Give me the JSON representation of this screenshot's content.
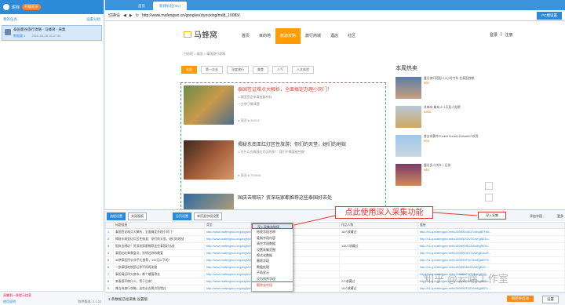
{
  "left": {
    "user": "昵称",
    "upgrade": "升级会员",
    "section": "我的任务",
    "section_action": "设置分组",
    "task_title": "泰国曼谷旅行攻略 - 马蜂窝 - 采集",
    "task_status": "数据量 1",
    "task_time": "2019-05-28 10:47:45",
    "notice": "采集到一条提示信息",
    "tutorial": "使用说明",
    "version": "软件版本: 2.1.22"
  },
  "browser": {
    "tabs": [
      "首页",
      "新建标签(Inc)"
    ],
    "mode": "切换设",
    "url": "http://www.mafengwo.cn/gonglve/ziyouxing/mdd_10083/",
    "pc_button": "PC端设置"
  },
  "site": {
    "logo_text": "马蜂窝",
    "nav": [
      "首页",
      "目的地",
      "旅游攻略",
      "旅行商城",
      "酒店",
      "社区"
    ],
    "login": [
      "登录",
      "|",
      "注册"
    ],
    "breadcrumb": "目的地 > 泰国 > 泰国旅行攻略",
    "chips": [
      "全部",
      "第一次去",
      "深度旅行",
      "美食",
      "人气",
      "人文体验"
    ],
    "articles": [
      {
        "title": "泰国签证难点大解析，全面搞定办理小窍门！",
        "sub": "1.泰国签证申请准备材料",
        "sub2": "一分钟了解清楚",
        "meta": "● 泰国 ● 36914"
      },
      {
        "title": "揭秘东南亚红灯区性旅游：你们的天堂，她们的地狱",
        "sub": "1.为什么去泰国红灯区的多？\"我们不需要被拯救\"",
        "sub2": "",
        "meta": "● 泰国 ● 763606"
      },
      {
        "title": "国庆去哪玩？资深玩家都推荐这些泰国好去处",
        "sub": "",
        "sub2": "",
        "meta": ""
      }
    ],
    "hot_title": "本周热卖",
    "hot": [
      {
        "desc": "曼谷旅行搭配 2.4小时专车 在泰国首都",
        "price": "¥55"
      },
      {
        "desc": "苏梅岛·象岛 4+1天双人船票",
        "price": "¥265"
      },
      {
        "desc": "普吉岛奢华Phuket Sunset Cabaret人妖秀",
        "price": "¥95"
      },
      {
        "desc": "曼谷多人拼车一日游",
        "price": "¥45"
      }
    ]
  },
  "panel": {
    "tools": [
      "流程设置",
      "关闭面板",
      "分页设置",
      "单页面字段设置"
    ],
    "deep": "深入采集",
    "add_field": "添加字段",
    "more": "更多",
    "columns": [
      "标题链接",
      "类型",
      "攻略链接",
      "文本",
      "作品人数",
      "链接"
    ],
    "rows": [
      [
        "1",
        "泰国签证难点大解析，全面搞定办理小窍门！",
        "http://www.mafengwo.cn/gonglve/ziyouxing/150012.html",
        "36914",
        "18人收藏过",
        "http://b4-q.mafengwo.net/s15/M00/48/37/wKgBEFbb..."
      ],
      [
        "2",
        "揭秘东南亚红灯区性旅游：你们的天堂，她们的地狱",
        "http://www.mafengwo.cn/gonglve/ziyouxing/7638.html",
        "763606",
        "",
        "http://n1-q.mafengwo.net/s10/M00/C6/3C/wKgBZ1x..."
      ],
      [
        "3",
        "国庆去哪玩？资深玩家都推荐这些泰国好去处",
        "http://www.mafengwo.cn/gonglve/ziyouxing/2.html",
        "59854",
        "133人收藏过",
        "http://n1-q.mafengwo.net/s15/M00/B1/A9/wKgBEFz..."
      ],
      [
        "4",
        "泰国必吃美食盘点，别错过你的最爱",
        "http://www.mafengwo.cn/gonglve/ziyouxing/32.html",
        "106361",
        "",
        "http://b4-q.mafengwo.net/s14/M00/A0/74/wKgE2mR..."
      ],
      [
        "5",
        "38种泰国平价伴手礼推荐，100元以下的！",
        "http://www.mafengwo.cn/gonglve/ziyouxing/2.html",
        "79186",
        "",
        "http://n1-q.mafengwo.net/s15/M00/F3/C8/wKgBEFX..."
      ],
      [
        "6",
        "一张泰国地铁图让你不用再迷路",
        "http://www.mafengwo.cn/gonglve/ziyouxing/58.html",
        "66106",
        "",
        "http://n1-q.mafengwo.net/s10/M00/A6/60/wKgBZ1..."
      ],
      [
        "7",
        "泰国清迈四大夜市，哪个最值得去",
        "http://www.mafengwo.cn/gonglve/ziyouxing/4.html",
        "84930",
        "",
        "http://b4-q.mafengwo.net/s12/M00/2C/F3/wKgED1..."
      ],
      [
        "8",
        "来泰国不做什么，等于白来！",
        "http://www.mafengwo.cn/gonglve/ziyouxing/6.html",
        "514640",
        "2人收藏过",
        "http://n1-q.mafengwo.net/s15/M00/0E/B1/wKgBEFx..."
      ],
      [
        "9",
        "普吉岛旅行攻略，这些必去景点别错过",
        "http://www.mafengwo.cn/gonglve/ziyouxing/7.html",
        "189371",
        "15人收藏过",
        "http://b1-q.mafengwo.net/s15/M00/F2/D4/wKgBEFx..."
      ]
    ],
    "context": [
      "深入采集该链接",
      "修改字段名称",
      "复制字段内容",
      "清空字段数据",
      "设置采集范围",
      "格式化数据",
      "删除字段",
      "数据处理",
      "不再显示",
      "设为排序字段",
      "删除该字段"
    ],
    "callout": "点此使用深入采集功能",
    "footer": "1 条数据已经采集 设置版",
    "save": "保存并启动",
    "settings": "设置"
  },
  "watermark": "知乎 @云端工作室"
}
